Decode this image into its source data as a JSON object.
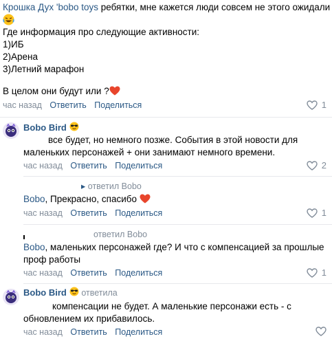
{
  "comment1": {
    "author": "Крошка Дух 'bobo toys",
    "text_line1": "ребятки, мне кажется люди совсем не этого ожидали",
    "text_line2": "Где информация про следующие активности:",
    "text_line3": "1)ИБ",
    "text_line4": "2)Арена",
    "text_line5": "3)Летний марафон",
    "text_line6": "В целом они будут или ?",
    "time": "час назад",
    "reply": "Ответить",
    "share": "Поделиться",
    "likes": "1"
  },
  "comment2": {
    "author": "Bobo Bird",
    "text_line1": "все будет, но немного позже. События в этой новости для",
    "text_line2": "маленьких персонажей + они занимают немного времени.",
    "time": "час назад",
    "reply": "Ответить",
    "share": "Поделиться",
    "likes": "2"
  },
  "comment3": {
    "replied_to": "ответил Bobo",
    "mention": "Bobo",
    "text": ", Прекрасно, спасибо",
    "time": "час назад",
    "reply": "Ответить",
    "share": "Поделиться",
    "likes": "1"
  },
  "comment4": {
    "replied_to": "ответил Bobo",
    "mention": "Bobo",
    "text_line1": ", маленьких персонажей где? И что с компенсацией за прошлые",
    "text_line2": "проф работы",
    "time": "час назад",
    "reply": "Ответить",
    "share": "Поделиться",
    "likes": "1"
  },
  "comment5": {
    "author": "Bobo Bird",
    "replied_to": "ответила",
    "text_line1": "компенсации не будет. А маленькие персонажи есть - с",
    "text_line2": "обновлением их прибавилось.",
    "time": "час назад",
    "reply": "Ответить",
    "share": "Поделиться"
  },
  "colors": {
    "link": "#2a5885",
    "meta": "#818c99",
    "heart_emoji": "#e8452c",
    "separator": "#e7e8ec"
  },
  "icons": {
    "like": "heart-outline-icon",
    "emoji_laugh": "laughing-emoji-icon",
    "emoji_heart": "red-heart-emoji-icon",
    "emoji_sunglasses": "sunglasses-emoji-icon"
  }
}
